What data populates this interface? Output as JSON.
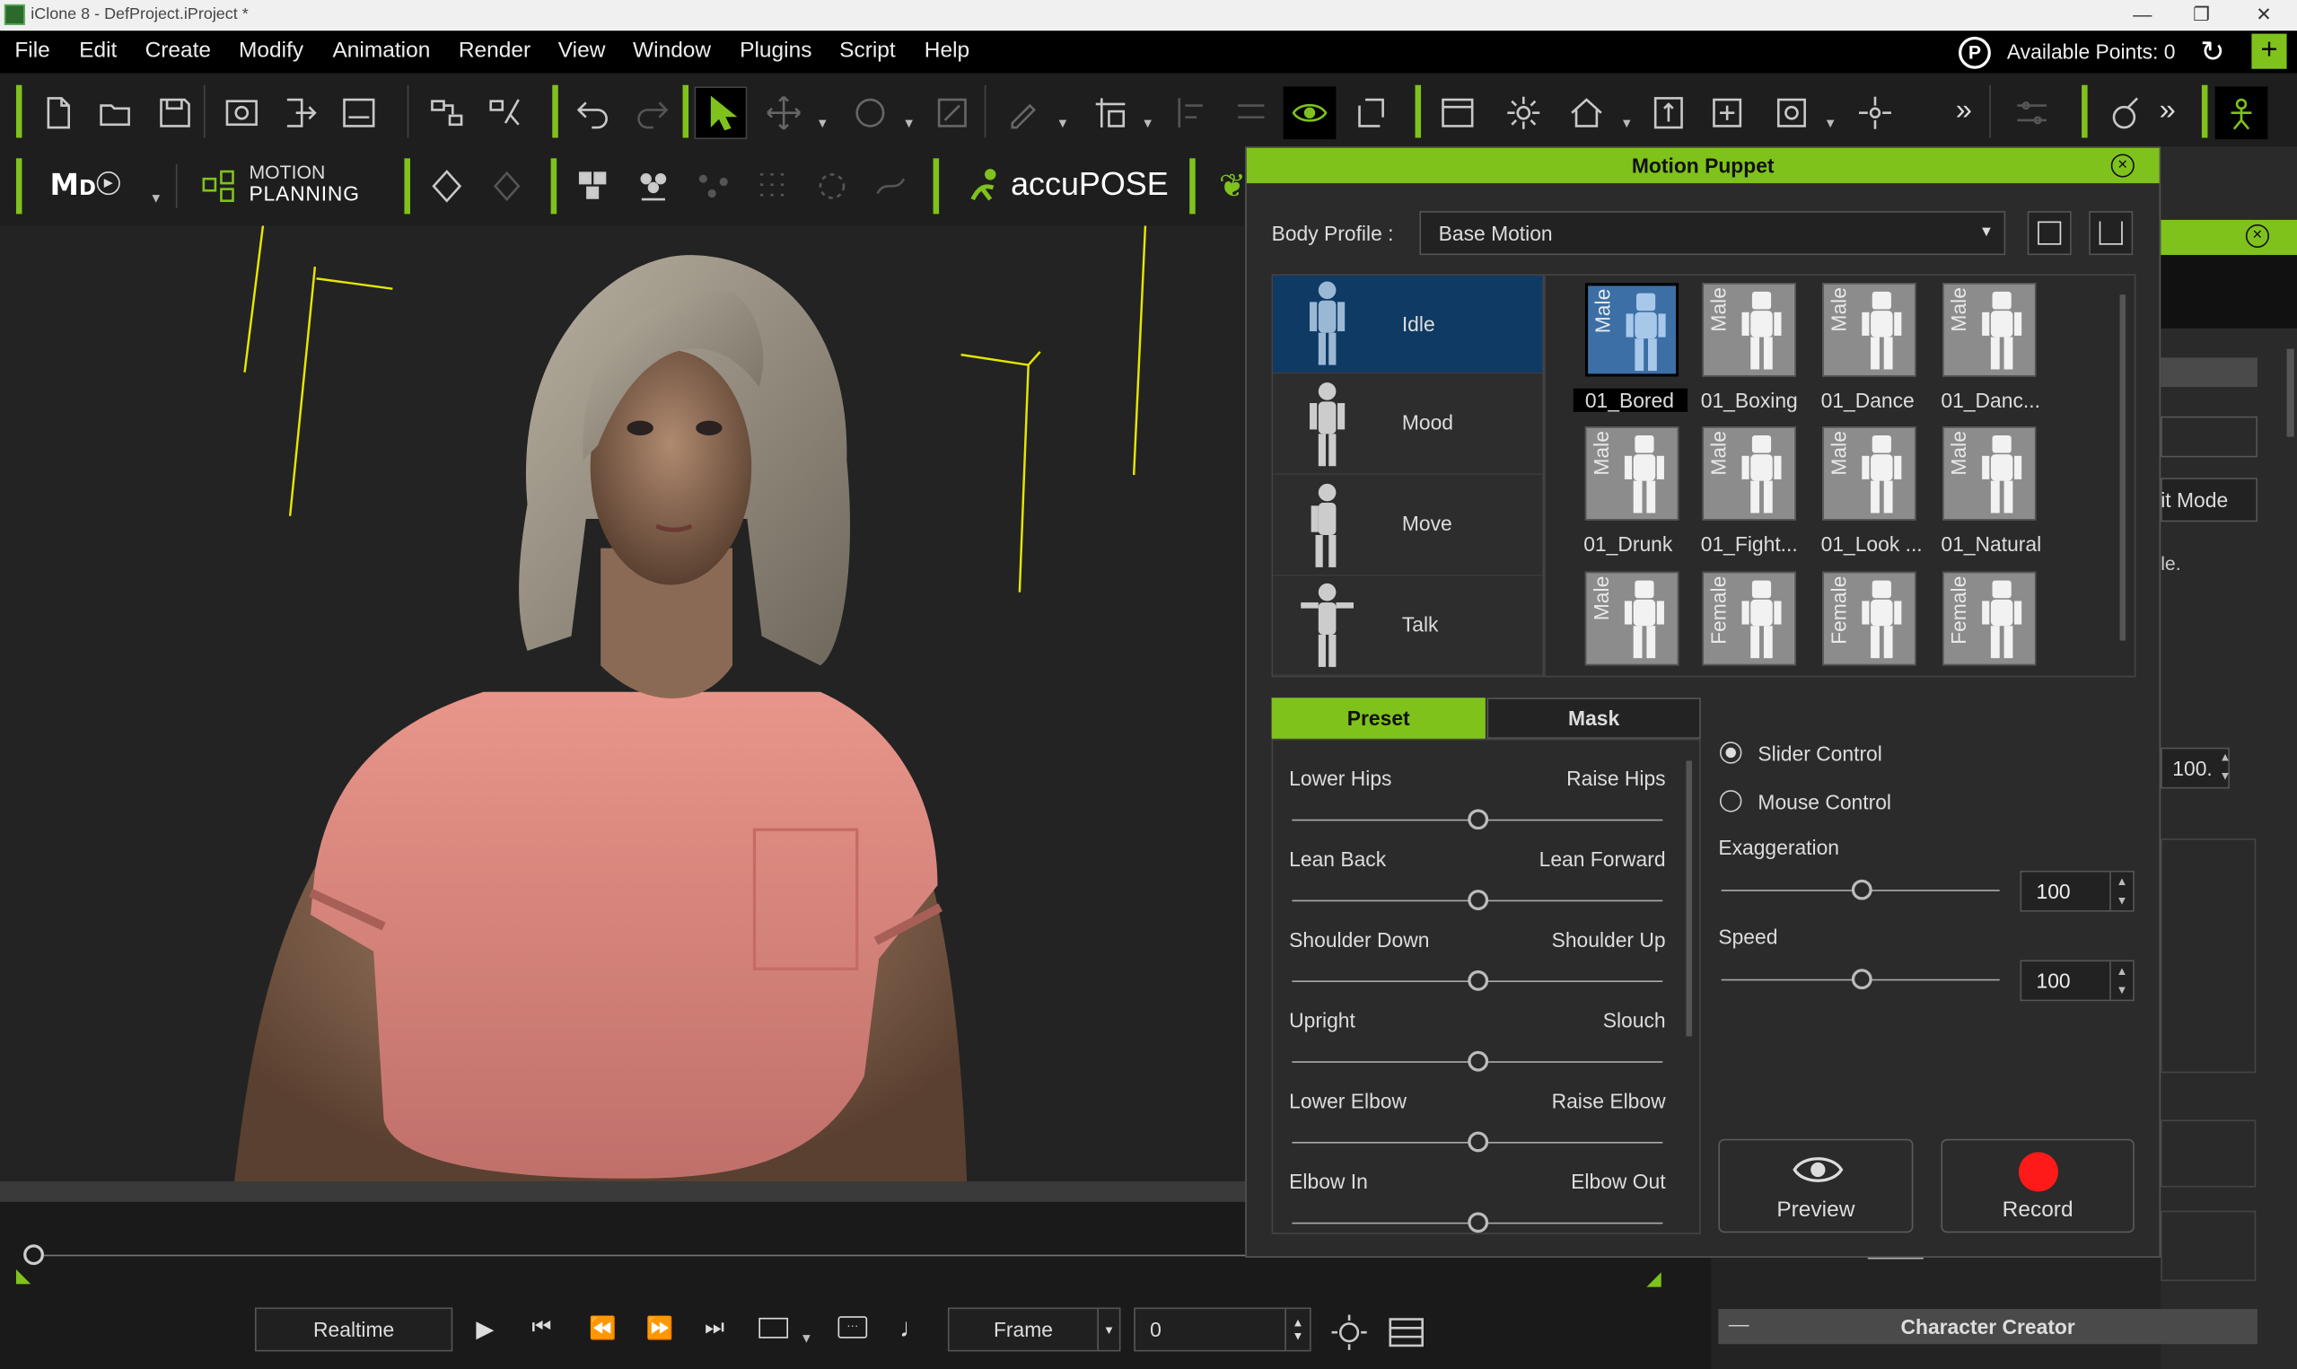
{
  "window": {
    "title": "iClone 8 - DefProject.iProject *"
  },
  "menu": [
    "File",
    "Edit",
    "Create",
    "Modify",
    "Animation",
    "Render",
    "View",
    "Window",
    "Plugins",
    "Script",
    "Help"
  ],
  "points": {
    "label": "Available Points: 0"
  },
  "toolbar2": {
    "motion_planning_line1": "MOTION",
    "motion_planning_line2": "PLANNING",
    "accupose": "accuPOSE"
  },
  "dialog": {
    "title": "Motion Puppet",
    "body_profile_label": "Body Profile :",
    "body_profile_value": "Base Motion",
    "categories": [
      {
        "label": "Idle"
      },
      {
        "label": "Mood"
      },
      {
        "label": "Move"
      },
      {
        "label": "Talk"
      }
    ],
    "thumbnails": [
      {
        "name": "01_Bored",
        "gender": "Male"
      },
      {
        "name": "01_Boxing",
        "gender": "Male"
      },
      {
        "name": "01_Dance",
        "gender": "Male"
      },
      {
        "name": "01_Danc...",
        "gender": "Male"
      },
      {
        "name": "01_Drunk",
        "gender": "Male"
      },
      {
        "name": "01_Fight...",
        "gender": "Male"
      },
      {
        "name": "01_Look ...",
        "gender": "Male"
      },
      {
        "name": "01_Natural",
        "gender": "Male"
      },
      {
        "name": "",
        "gender": "Male"
      },
      {
        "name": "",
        "gender": "Female"
      },
      {
        "name": "",
        "gender": "Female"
      },
      {
        "name": "",
        "gender": "Female"
      }
    ],
    "tabs": {
      "preset": "Preset",
      "mask": "Mask"
    },
    "sliders": [
      {
        "left": "Lower Hips",
        "right": "Raise Hips"
      },
      {
        "left": "Lean Back",
        "right": "Lean Forward"
      },
      {
        "left": "Shoulder Down",
        "right": "Shoulder Up"
      },
      {
        "left": "Upright",
        "right": "Slouch"
      },
      {
        "left": "Lower Elbow",
        "right": "Raise Elbow"
      },
      {
        "left": "Elbow In",
        "right": "Elbow Out"
      }
    ],
    "control": {
      "slider": "Slider Control",
      "mouse": "Mouse Control"
    },
    "exaggeration": {
      "label": "Exaggeration",
      "value": "100"
    },
    "speed": {
      "label": "Speed",
      "value": "100"
    },
    "preview_label": "Preview",
    "record_label": "Record"
  },
  "right_panel": {
    "mode_fragment": "it Mode",
    "text_fragment": "le.",
    "value_fragment": "100.",
    "footer": "Character Creator"
  },
  "timeline": {
    "realtime": "Realtime",
    "frame_label": "Frame",
    "frame_value": "0"
  },
  "colors": {
    "accent": "#7fc21c",
    "record": "#ff1a1a",
    "selected_category": "#0f3a64"
  }
}
